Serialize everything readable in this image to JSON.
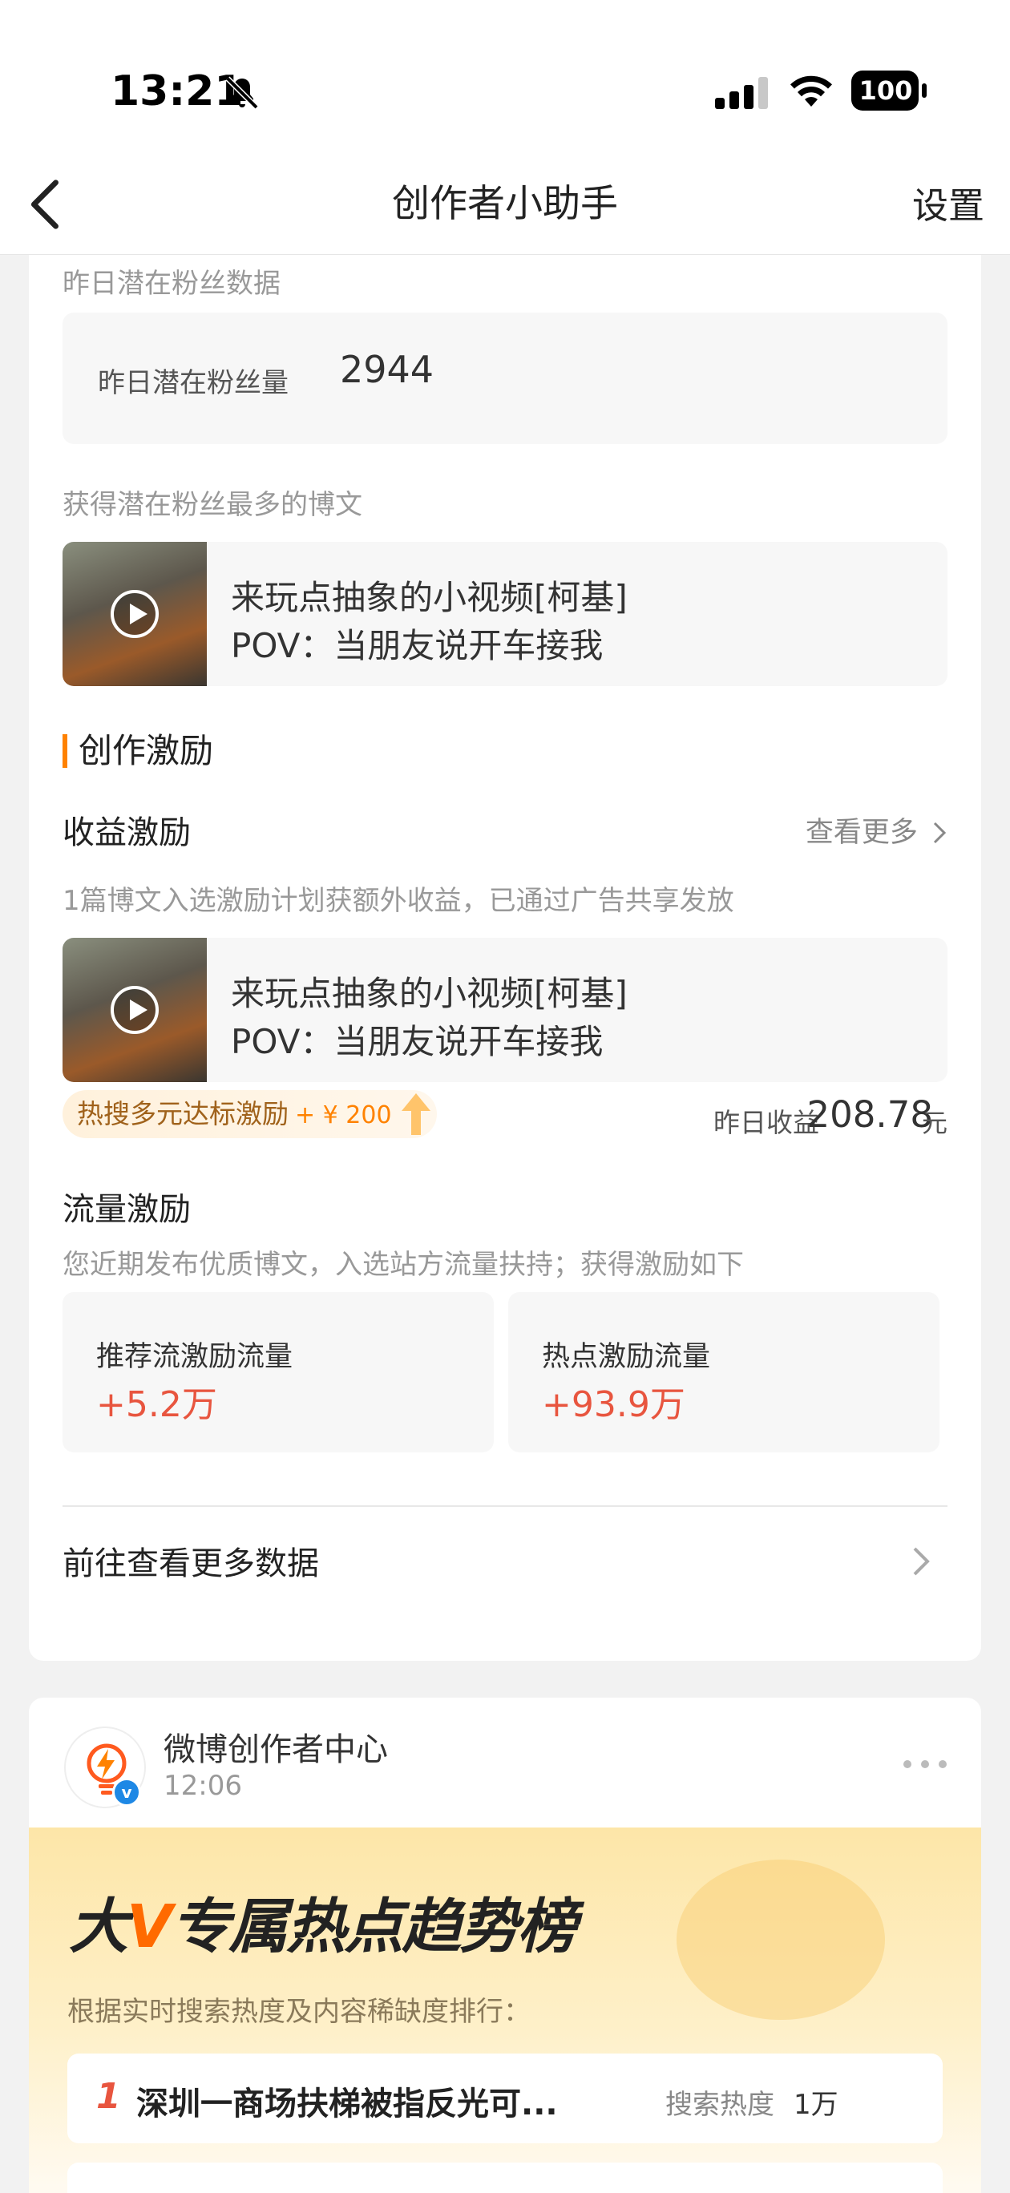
{
  "status_bar": {
    "time": "13:21",
    "battery": "100"
  },
  "nav": {
    "title": "创作者小助手",
    "settings": "设置"
  },
  "fans": {
    "section_label": "昨日潜在粉丝数据",
    "label": "昨日潜在粉丝量",
    "value": "2944",
    "top_post_label": "获得潜在粉丝最多的博文"
  },
  "post": {
    "line1": "来玩点抽象的小视频[柯基]",
    "line2": "POV：当朋友说开车接我"
  },
  "incentive": {
    "section_title": "创作激励",
    "income_title": "收益激励",
    "more": "查看更多",
    "income_desc": "1篇博文入选激励计划获额外收益，已通过广告共享发放",
    "badge_text": "热搜多元达标激励",
    "badge_amount": "+ ¥ 200",
    "yesterday_label": "昨日收益",
    "yesterday_value": "208.78",
    "yesterday_unit": "元",
    "flow_title": "流量激励",
    "flow_desc": "您近期发布优质博文，入选站方流量扶持；获得激励如下",
    "flow_items": [
      {
        "label": "推荐流激励流量",
        "value": "+5.2万"
      },
      {
        "label": "热点激励流量",
        "value": "+93.9万"
      }
    ],
    "go_more": "前往查看更多数据"
  },
  "feed": {
    "account_name": "微博创作者中心",
    "time": "12:06",
    "banner_title_prefix": "大",
    "banner_title_v": "V",
    "banner_title_rest": "专属热点趋势榜",
    "banner_sub": "根据实时搜索热度及内容稀缺度排行：",
    "rank": [
      {
        "num": "1",
        "title": "深圳一商场扶梯被指反光可...",
        "heat_label": "搜索热度",
        "heat_value": "1万"
      }
    ]
  }
}
